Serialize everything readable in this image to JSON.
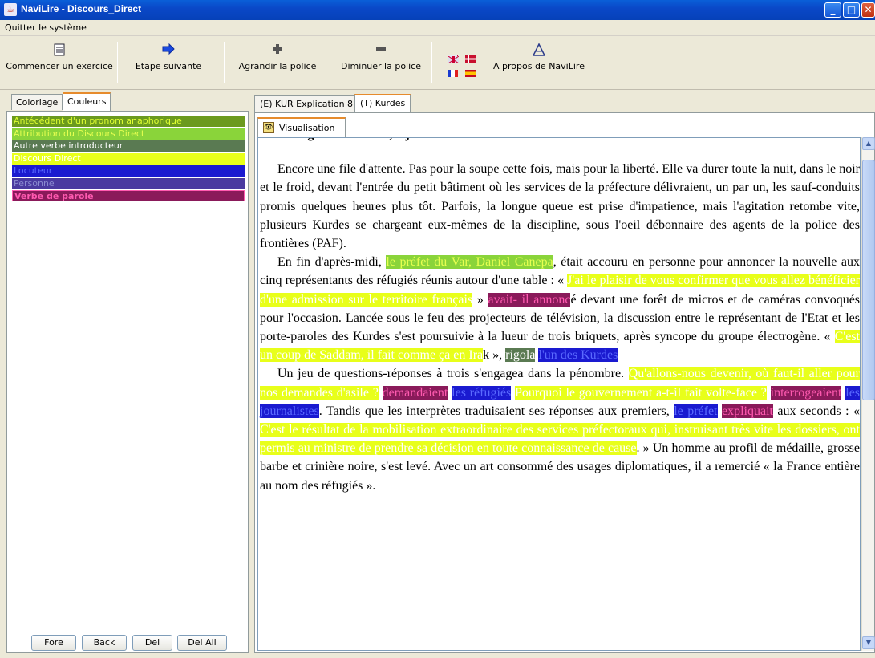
{
  "window": {
    "title": "NaviLire - Discours_Direct"
  },
  "menu": {
    "items": [
      "Quitter le système"
    ]
  },
  "toolbar": {
    "start": "Commencer un exercice",
    "next": "Etape suivante",
    "bigger": "Agrandir la police",
    "smaller": "Diminuer la police",
    "about": "A propos de NaviLire"
  },
  "left_tabs": [
    "Coloriage",
    "Couleurs"
  ],
  "colors": [
    {
      "label": "Antécédent d'un pronom anaphorique",
      "bg": "#6b9a1e",
      "fg": "#e0ff30"
    },
    {
      "label": "Attribution du Discours Direct",
      "bg": "#8ad43a",
      "fg": "#e8ff50"
    },
    {
      "label": "Autre verbe introducteur",
      "bg": "#5a7a52",
      "fg": "#ffffff"
    },
    {
      "label": "Discours Direct",
      "bg": "#e8ff1a",
      "fg": "#ffffff"
    },
    {
      "label": "Locuteur",
      "bg": "#1a1ad0",
      "fg": "#5a6aff"
    },
    {
      "label": "Personne",
      "bg": "#4a3aa0",
      "fg": "#8a8ad0"
    },
    {
      "label": "Verbe de parole",
      "bg": "#8a1a5a",
      "fg": "#ff5ab0"
    }
  ],
  "buttons": {
    "fore": "Fore",
    "back": "Back",
    "del": "Del",
    "del_all": "Del All"
  },
  "right_tabs": [
    "(E) KUR Explication 8",
    "(T) Kurdes"
  ],
  "subtab": "Visualisation",
  "doc": {
    "heading": "Premier geste de liberté, « juste boire un café au centre-ville »",
    "p1": "Encore une file d'attente. Pas pour la soupe cette fois, mais pour la liberté. Elle va durer toute la nuit, dans le noir et le froid, devant l'entrée du petit bâtiment où les services de la préfecture délivraient, un par un, les sauf-conduits promis quelques heures plus tôt. Parfois, la longue queue est prise d'impatience, mais l'agitation retombe vite, plusieurs Kurdes se chargeant eux-mêmes de la discipline, sous l'oeil débonnaire des agents de la police des frontières (PAF).",
    "p2_a": "En fin d'après-midi, ",
    "p2_b": "le préfet du Var, Daniel Canepa",
    "p2_c": ", était accouru en personne pour annoncer la nouvelle aux cinq représentants des réfugiés réunis autour d'une table : « ",
    "p2_d": "J'ai le plaisir de vous confirmer que vous allez bénéficier d'une admission sur le territoire français",
    "p2_e": " » ",
    "p2_f": "avait- il annonc",
    "p2_g": "é devant une forêt de micros et de caméras convoqués pour l'occasion. Lancée sous le feu des projecteurs de télévision, la discussion entre le représentant de l'Etat et les porte-paroles des Kurdes s'est poursuivie à la lueur de trois briquets, après syncope du groupe électrogène. « ",
    "p2_h": "C'est un coup de Saddam, il fait comme ça en Ira",
    "p2_i": "k », ",
    "p2_j": "rigola",
    "p2_k": " ",
    "p2_l": "l'un des Kurdes",
    "p3_a": "Un jeu de questions-réponses à trois s'engagea dans la pénombre. ",
    "p3_b": "Qu'allons-nous devenir, où faut-il aller pour nos demandes d'asile ?",
    "p3_c": " ",
    "p3_d": "demandaient",
    "p3_e": " ",
    "p3_f": "les réfugiés",
    "p3_g": " ",
    "p3_h": "Pourquoi le gouvernement a-t-il fait volte-face ?",
    "p3_i": " ",
    "p3_j": "interrogeaient",
    "p3_k": " ",
    "p3_l": "les journalistes",
    "p3_m": ". Tandis que les interprètes traduisaient ses réponses aux premiers, ",
    "p3_n": "le préfet",
    "p3_o": " ",
    "p3_p": "expliquait",
    "p3_q": " aux seconds : « ",
    "p3_r": "  C'est le résultat de la mobilisation extraordinaire des services préfectoraux qui, instruisant très vite les dossiers, ont permis au ministre de prendre sa décision en toute connaissance de cause",
    "p3_s": ". » Un homme au profil de médaille, grosse barbe et crinière noire, s'est levé. Avec un art consommé des usages diplomatiques, il a remercié « la France entière au nom des réfugiés »."
  }
}
